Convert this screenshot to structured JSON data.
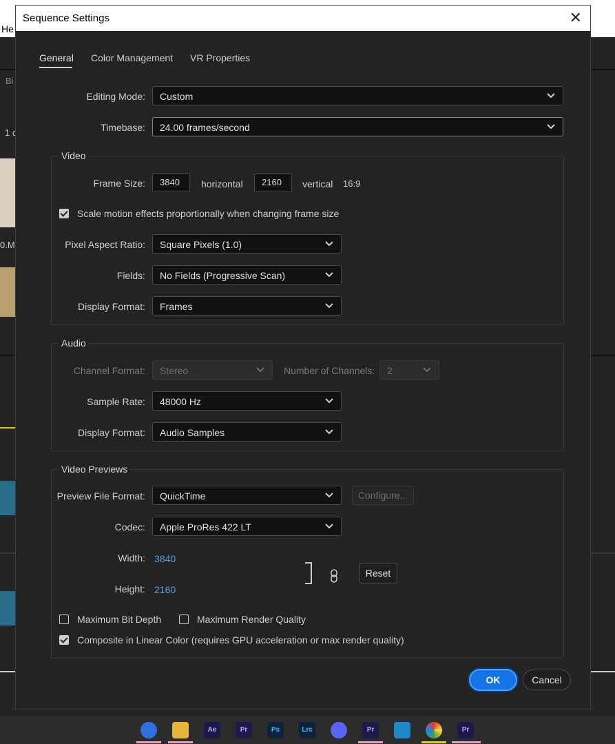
{
  "background": {
    "partial_text_top": "He",
    "left_labels": [
      "Bi",
      "1 c",
      "0.M"
    ]
  },
  "dialog": {
    "title": "Sequence Settings",
    "tabs": [
      {
        "label": "General",
        "active": true
      },
      {
        "label": "Color Management",
        "active": false
      },
      {
        "label": "VR Properties",
        "active": false
      }
    ],
    "editing_mode": {
      "label": "Editing Mode:",
      "value": "Custom"
    },
    "timebase": {
      "label": "Timebase:",
      "value": "24.00  frames/second"
    },
    "video": {
      "title": "Video",
      "frame_size_label": "Frame Size:",
      "frame_width": "3840",
      "horizontal_label": "horizontal",
      "frame_height": "2160",
      "vertical_label": "vertical",
      "aspect_label": "16:9",
      "scale_motion": {
        "label": "Scale motion effects proportionally when changing frame size",
        "checked": true
      },
      "pixel_aspect_ratio": {
        "label": "Pixel Aspect Ratio:",
        "value": "Square Pixels (1.0)"
      },
      "fields": {
        "label": "Fields:",
        "value": "No Fields (Progressive Scan)"
      },
      "display_format": {
        "label": "Display Format:",
        "value": "Frames"
      }
    },
    "audio": {
      "title": "Audio",
      "channel_format": {
        "label": "Channel Format:",
        "value": "Stereo",
        "disabled": true
      },
      "number_of_channels": {
        "label": "Number of Channels:",
        "value": "2",
        "disabled": true
      },
      "sample_rate": {
        "label": "Sample Rate:",
        "value": "48000 Hz"
      },
      "display_format": {
        "label": "Display Format:",
        "value": "Audio Samples"
      }
    },
    "video_previews": {
      "title": "Video Previews",
      "preview_file_format": {
        "label": "Preview File Format:",
        "value": "QuickTime"
      },
      "configure_label": "Configure...",
      "codec": {
        "label": "Codec:",
        "value": "Apple ProRes 422 LT"
      },
      "width_label": "Width:",
      "width_value": "3840",
      "height_label": "Height:",
      "height_value": "2160",
      "reset_label": "Reset",
      "max_bit_depth": {
        "label": "Maximum Bit Depth",
        "checked": false
      },
      "max_render_quality": {
        "label": "Maximum Render Quality",
        "checked": false
      },
      "composite_linear": {
        "label": "Composite in Linear Color (requires GPU acceleration or max render quality)",
        "checked": true
      }
    },
    "ok_label": "OK",
    "cancel_label": "Cancel"
  },
  "taskbar": {
    "icons": [
      {
        "name": "firefox-icon",
        "text": "",
        "color": "#2f6fe0"
      },
      {
        "name": "file-explorer-icon",
        "text": "",
        "color": "#e8b53a"
      },
      {
        "name": "after-effects-icon",
        "text": "Ae",
        "color": "#1c1a4a"
      },
      {
        "name": "premiere-pro-icon",
        "text": "Pr",
        "color": "#1c1a4a"
      },
      {
        "name": "photoshop-icon",
        "text": "Ps",
        "color": "#0c2238"
      },
      {
        "name": "lightroom-classic-icon",
        "text": "Lrc",
        "color": "#0c2238"
      },
      {
        "name": "discord-icon",
        "text": "",
        "color": "#5865f2"
      },
      {
        "name": "premiere-pro-icon-2",
        "text": "Pr",
        "color": "#1c1a4a"
      },
      {
        "name": "camera-icon",
        "text": "",
        "color": "#1e88c8"
      },
      {
        "name": "davinci-icon",
        "text": "",
        "color": "#303030"
      },
      {
        "name": "premiere-pro-icon-3",
        "text": "Pr",
        "color": "#1c1a4a"
      }
    ]
  }
}
